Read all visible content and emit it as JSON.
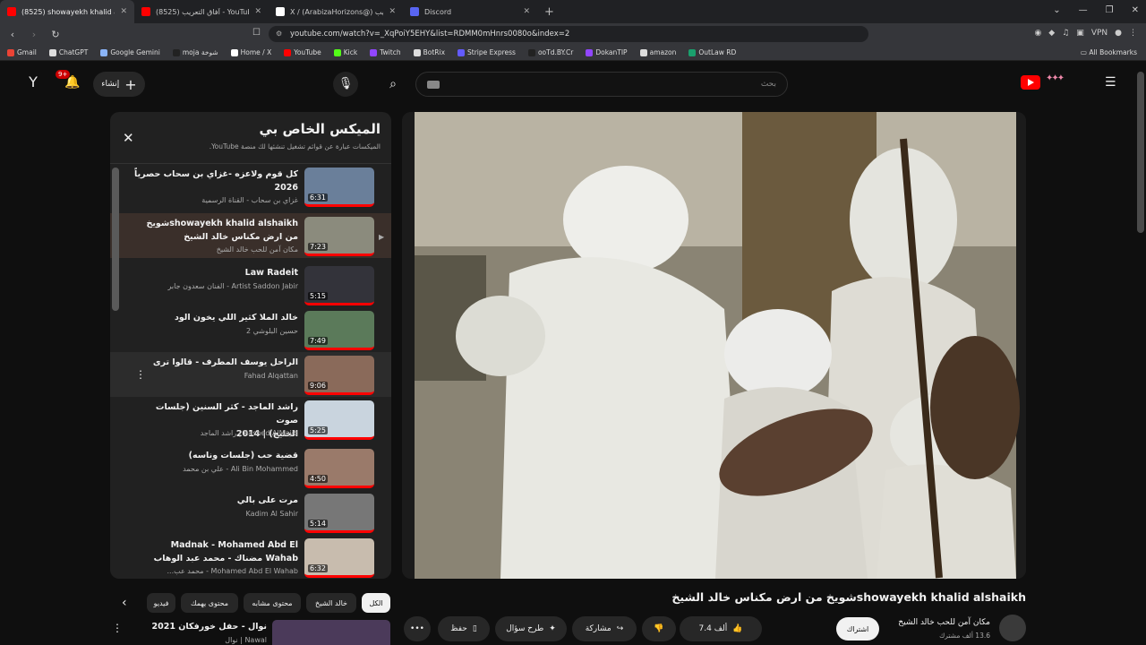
{
  "browser": {
    "tabs": [
      {
        "label": "(8525) showayekh khalid al...",
        "active": true,
        "color": "#ff0000"
      },
      {
        "label": "آفاق التعريب (8525) - YouTube",
        "active": false,
        "color": "#ff0000"
      },
      {
        "label": "X / (ArabizaHorizons@) آفاق التعريب",
        "active": false,
        "color": "#ffffff"
      },
      {
        "label": "Discord",
        "active": false,
        "color": "#5865f2"
      }
    ],
    "new_tab": "+",
    "url": "youtube.com/watch?v=_XqPoiY5EHY&list=RDMM0mHnrs0080o&index=2",
    "vpn_label": "VPN",
    "bookmarks": [
      {
        "label": "Gmail",
        "color": "#ea4335"
      },
      {
        "label": "ChatGPT",
        "color": "#dddddd"
      },
      {
        "label": "Google Gemini",
        "color": "#8ab4f8"
      },
      {
        "label": "moja شوخة",
        "color": "#222222"
      },
      {
        "label": "Home / X",
        "color": "#ffffff"
      },
      {
        "label": "YouTube",
        "color": "#ff0000"
      },
      {
        "label": "Kick",
        "color": "#53fc18"
      },
      {
        "label": "Twitch",
        "color": "#9146ff"
      },
      {
        "label": "BotRix",
        "color": "#dddddd"
      },
      {
        "label": "Stripe Express",
        "color": "#635bff"
      },
      {
        "label": "ooTd.BY.Cr",
        "color": "#222222"
      },
      {
        "label": "DokanTIP",
        "color": "#9146ff"
      },
      {
        "label": "amazon",
        "color": "#dddddd"
      },
      {
        "label": "OutLaw RD",
        "color": "#1aa06d"
      }
    ],
    "all_bookmarks": "All Bookmarks"
  },
  "yt_header": {
    "account_letter": "Y",
    "notif_count": "9+",
    "create_label": "إنشاء",
    "search_placeholder": "بحث",
    "brand_color": "#ff0000"
  },
  "playlist": {
    "title": "الميكس الخاص بي",
    "subtitle": "الميكسات عبارة عن قوائم تشغيل تنشئها لك منصة YouTube.",
    "items": [
      {
        "title": "كل قوم ولاعزه -غزاي بن سحاب حصرياً\n2026",
        "channel": "غزاي بن سحاب - القناة الرسمية",
        "duration": "6:31",
        "thumb": "#6a7f9a"
      },
      {
        "title": "showayekh khalid alshaikhشويخ\nمن ارض مكناس خالد الشيخ",
        "channel": "مكان آمن للحب خالد الشيخ",
        "duration": "7:23",
        "thumb": "#8b8b7d"
      },
      {
        "title": "Law Radeit",
        "channel": "Artist Saddon Jabir - الفنان سعدون جابر",
        "duration": "5:15",
        "thumb": "#33333a"
      },
      {
        "title": "خالد الملا كثير اللي يخون الود",
        "channel": "حسين البلوشي 2",
        "duration": "7:49",
        "thumb": "#5b7a5a"
      },
      {
        "title": "الراحل يوسف المطرف - قالوا ترى",
        "channel": "Fahad Alqattan",
        "duration": "9:06",
        "thumb": "#8a6a5a"
      },
      {
        "title": "راشد الماجد - كثر السنين (جلسات صوت\nالخليج) | 2014",
        "channel": "Rashed AlMajid | راشد الماجد",
        "duration": "5:25",
        "thumb": "#c9d4de"
      },
      {
        "title": "قضية حب (جلسات وناسه)",
        "channel": "Ali Bin Mohammed - علي بن محمد",
        "duration": "4:50",
        "thumb": "#9a7a6a"
      },
      {
        "title": "مرت على بالي",
        "channel": "Kadim Al Sahir",
        "duration": "5:14",
        "thumb": "#777777"
      },
      {
        "title": "Madnak - Mohamed Abd El\nWahab مضناك - محمد عبد الوهاب",
        "channel": "Mohamed Abd El Wahab - محمد عب...",
        "duration": "6:32",
        "thumb": "#c8bcae"
      }
    ]
  },
  "chips": [
    {
      "label": "الكل",
      "selected": true
    },
    {
      "label": "خالد الشيخ",
      "selected": false
    },
    {
      "label": "محتوى مشابه",
      "selected": false
    },
    {
      "label": "محتوى يهمك",
      "selected": false
    },
    {
      "label": "فيديو",
      "selected": false
    }
  ],
  "next_up": {
    "title": "نوال - حفل خورفكان 2021",
    "channel": "Nawal | نوال"
  },
  "video": {
    "title": "showayekh khalid alshaikhشويخ من ارض مكناس خالد الشيخ",
    "channel_name": "مكان آمن للحب خالد الشيخ",
    "subscribers": "13.6 ألف مشترك",
    "subscribe_label": "اشتراك",
    "likes": "7.4 ألف",
    "share_label": "مشاركة",
    "ask_label": "طرح سؤال",
    "save_label": "حفظ",
    "more_label": "•••"
  }
}
